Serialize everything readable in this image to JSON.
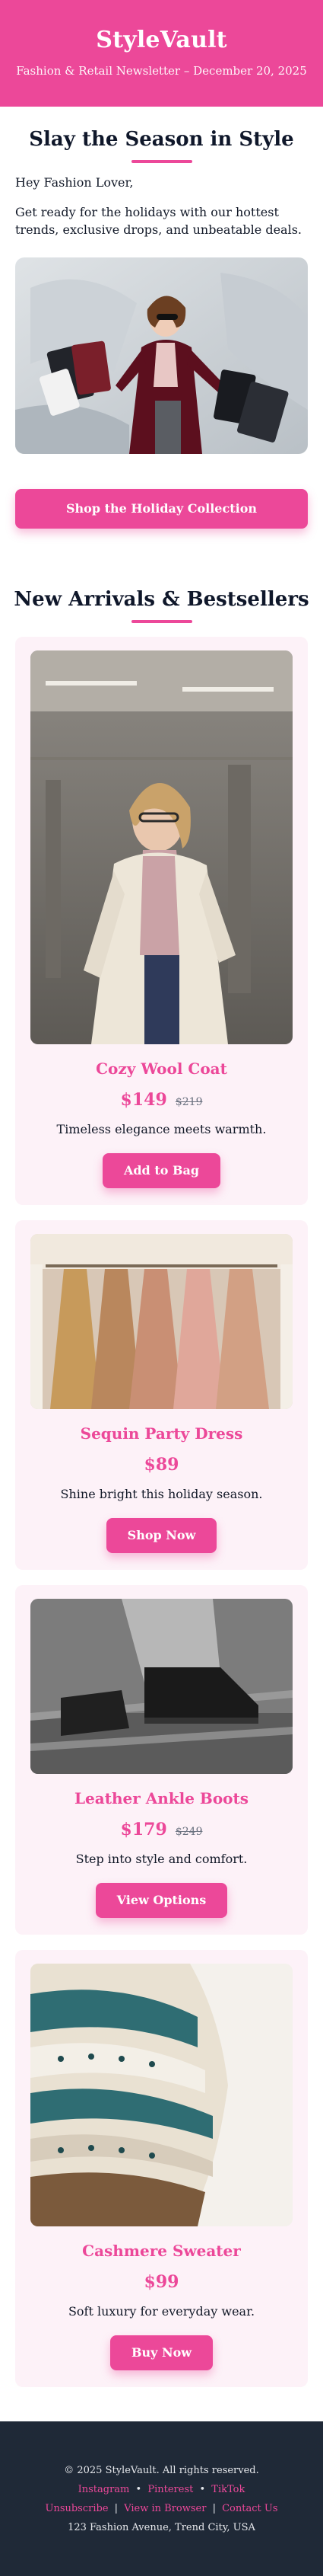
{
  "header": {
    "brand": "StyleVault",
    "subtitle": "Fashion & Retail Newsletter – December 20, 2025"
  },
  "intro": {
    "title": "Slay the Season in Style",
    "greeting": "Hey Fashion Lover,",
    "body": "Get ready for the holidays with our hottest trends, exclusive drops, and unbeatable deals.",
    "cta": "Shop the Holiday Collection",
    "hero_alt": "Woman in sunglasses carrying shopping bags"
  },
  "products_section": {
    "title": "New Arrivals & Bestsellers",
    "items": [
      {
        "name": "Cozy Wool Coat",
        "price": "$149",
        "old_price": "$219",
        "desc": "Timeless elegance meets warmth.",
        "button": "Add to Bag"
      },
      {
        "name": "Sequin Party Dress",
        "price": "$89",
        "old_price": "",
        "desc": "Shine bright this holiday season.",
        "button": "Shop Now"
      },
      {
        "name": "Leather Ankle Boots",
        "price": "$179",
        "old_price": "$249",
        "desc": "Step into style and comfort.",
        "button": "View Options"
      },
      {
        "name": "Cashmere Sweater",
        "price": "$99",
        "old_price": "",
        "desc": "Soft luxury for everyday wear.",
        "button": "Buy Now"
      }
    ]
  },
  "footer": {
    "copyright": "© 2025 StyleVault. All rights reserved.",
    "social": [
      "Instagram",
      "Pinterest",
      "TikTok"
    ],
    "links": [
      "Unsubscribe",
      "View in Browser",
      "Contact Us"
    ],
    "address": "123 Fashion Avenue, Trend City, USA"
  },
  "colors": {
    "accent": "#ec4899",
    "card_bg": "#fdf2f8",
    "footer_bg": "#1f2937"
  }
}
